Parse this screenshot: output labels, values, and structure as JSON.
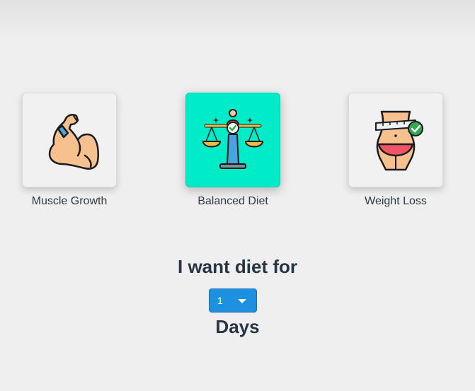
{
  "goals": [
    {
      "label": "Muscle Growth",
      "icon": "flexed-arm-icon",
      "selected": false
    },
    {
      "label": "Balanced Diet",
      "icon": "balance-scale-icon",
      "selected": true
    },
    {
      "label": "Weight Loss",
      "icon": "waist-measure-icon",
      "selected": false
    }
  ],
  "selected_color": "#00ebc7",
  "plan": {
    "heading": "I want diet for",
    "days_value": "1",
    "days_label": "Days"
  }
}
